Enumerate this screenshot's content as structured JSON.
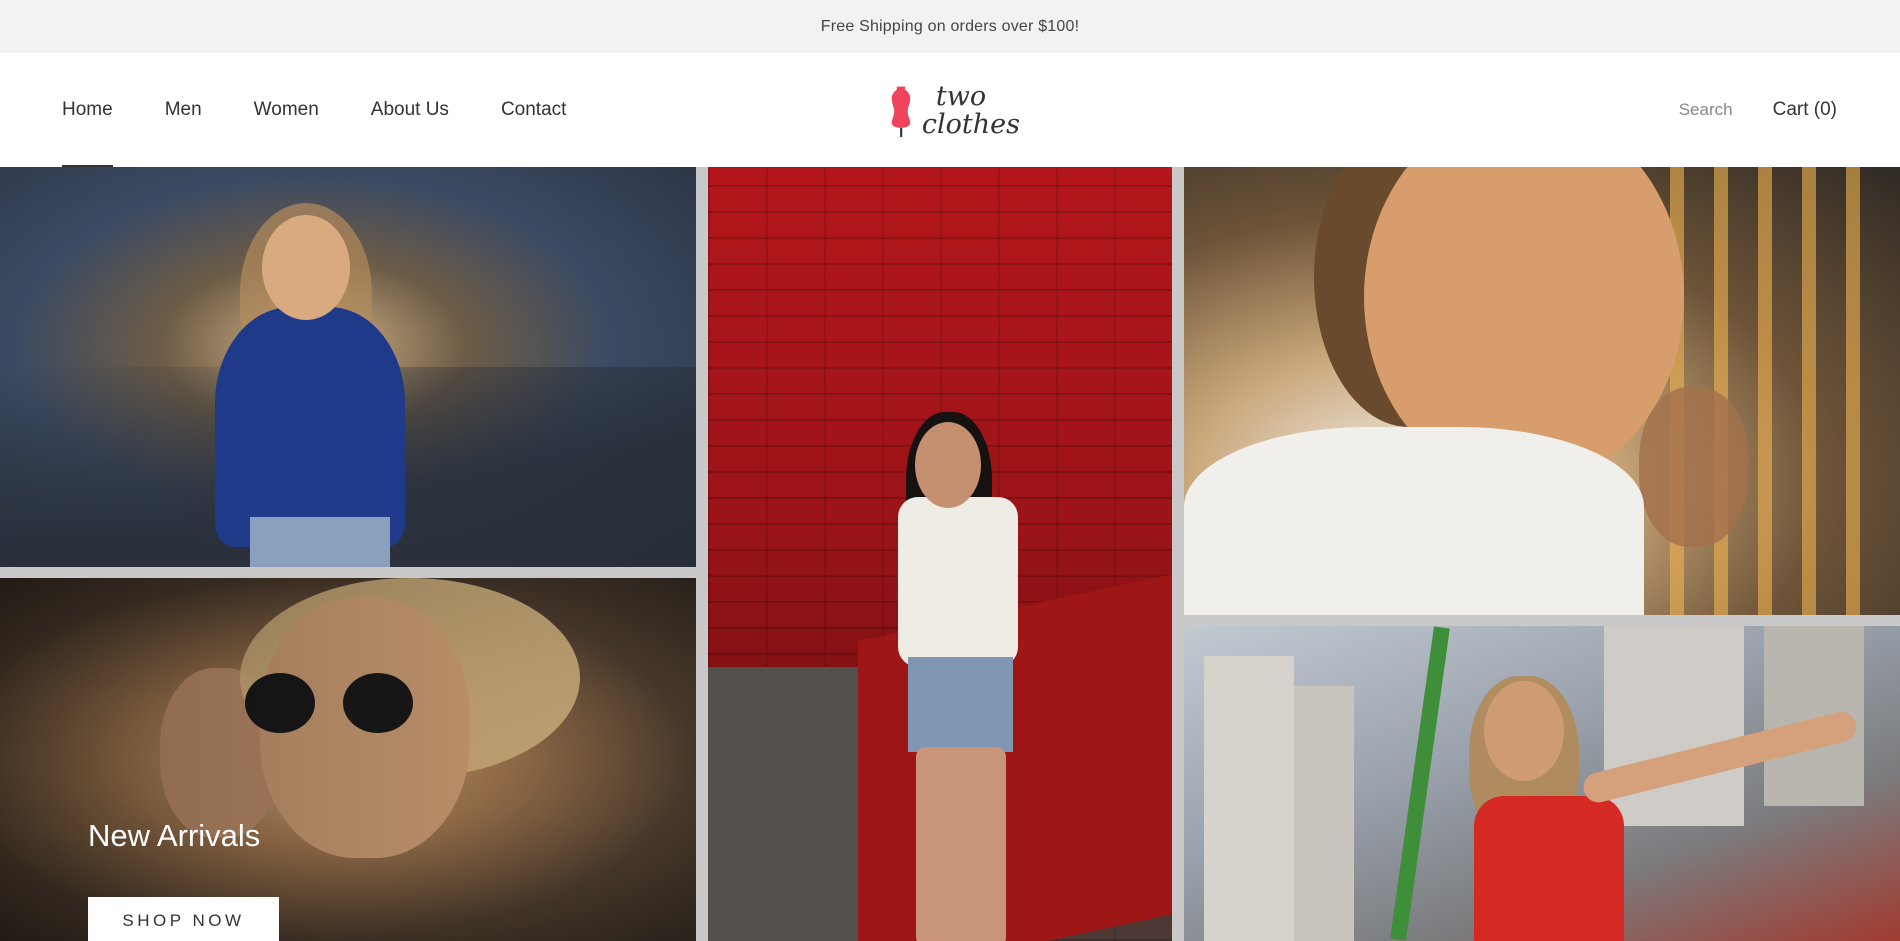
{
  "announcement": {
    "text": "Free Shipping on orders over $100!"
  },
  "nav": {
    "items": [
      {
        "label": "Home",
        "active": true
      },
      {
        "label": "Men",
        "active": false
      },
      {
        "label": "Women",
        "active": false
      },
      {
        "label": "About Us",
        "active": false
      },
      {
        "label": "Contact",
        "active": false
      }
    ]
  },
  "logo": {
    "line1": "two",
    "line2": "clothes",
    "icon": "dress-form-icon",
    "color": "#f0445d"
  },
  "header_tools": {
    "search_label": "Search",
    "cart_label": "Cart (0)"
  },
  "hero": {
    "title": "New Arrivals",
    "button_label": "SHOP NOW",
    "images": [
      "woman-blue-shirt-fairground",
      "couple-sunglasses",
      "woman-red-brick-wall",
      "man-profile-sunset",
      "woman-pointing-city"
    ]
  }
}
